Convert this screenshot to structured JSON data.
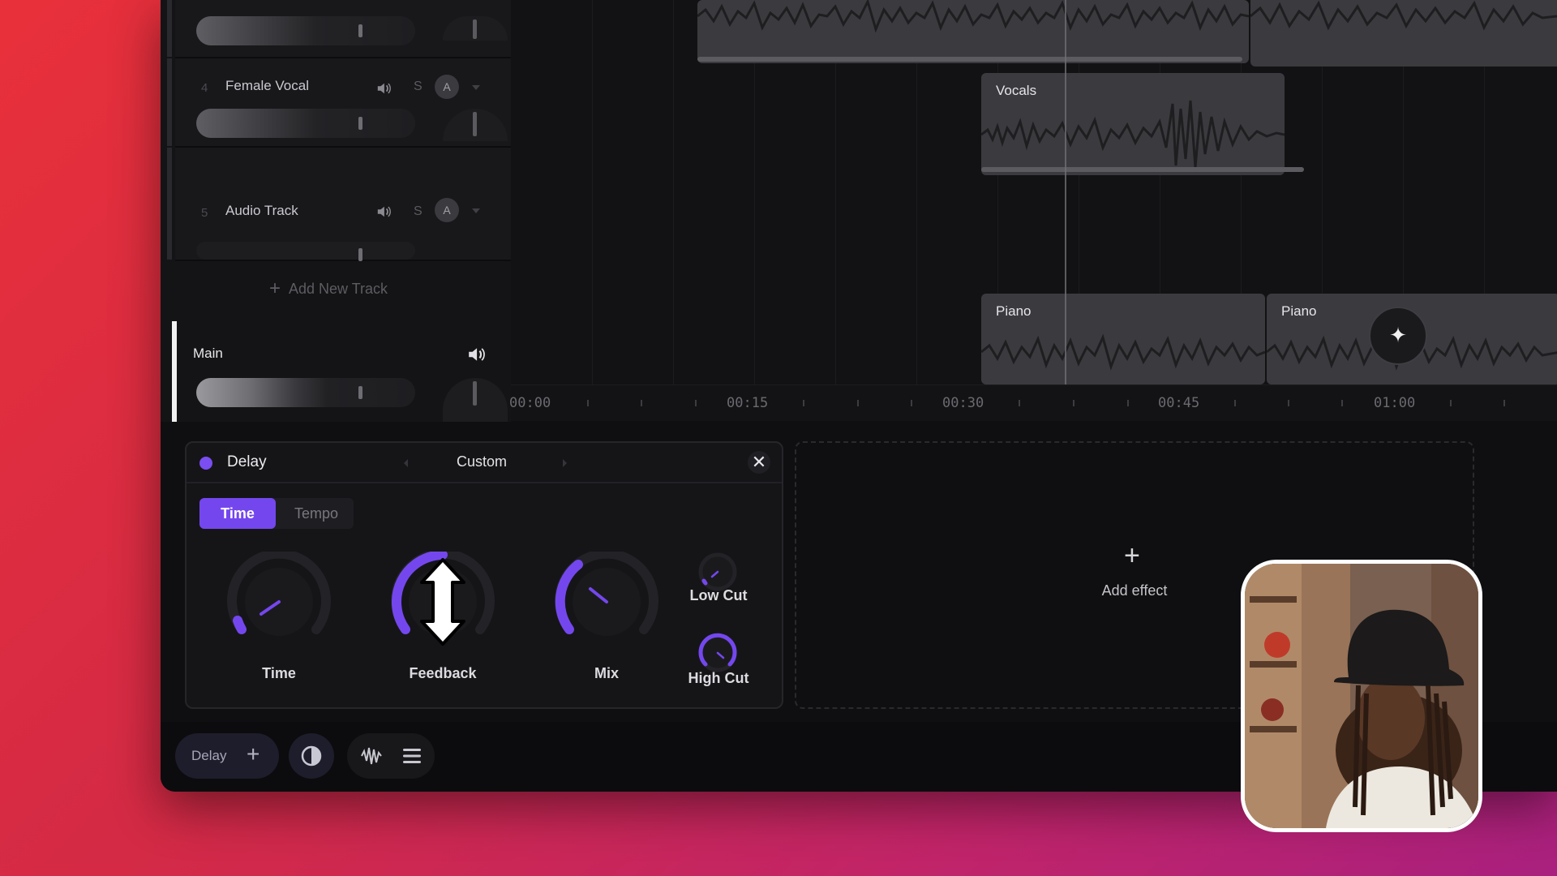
{
  "tracks": [
    {
      "number": "",
      "name": ""
    },
    {
      "number": "4",
      "name": "Female Vocal",
      "solo": "S",
      "automation": "A"
    },
    {
      "number": "5",
      "name": "Audio Track",
      "solo": "S",
      "automation": "A"
    }
  ],
  "add_track_label": "Add New Track",
  "main": {
    "name": "Main"
  },
  "clips": [
    {
      "name": "Vocals"
    },
    {
      "name": "Piano"
    },
    {
      "name": "Piano"
    }
  ],
  "ruler": {
    "labels": [
      "00:00",
      "00:15",
      "00:30",
      "00:45",
      "01:00"
    ]
  },
  "effect": {
    "name": "Delay",
    "preset": "Custom",
    "modes": {
      "active": "Time",
      "inactive": "Tempo"
    },
    "knobs": {
      "time": {
        "label": "Time",
        "value": 0.12
      },
      "feedback": {
        "label": "Feedback",
        "value": 0.55
      },
      "mix": {
        "label": "Mix",
        "value": 0.3
      },
      "low_cut": {
        "label": "Low Cut",
        "value": 0.05
      },
      "high_cut": {
        "label": "High Cut",
        "value": 0.85
      }
    },
    "accent_color": "#7447ee"
  },
  "add_effect_label": "Add effect",
  "toolbar": {
    "effect_pill": "Delay"
  },
  "icons": [
    "speaker-icon",
    "close-icon",
    "plus-icon",
    "sparkle-icon",
    "contrast-icon",
    "waveform-icon",
    "list-icon",
    "resize-cursor-icon"
  ]
}
